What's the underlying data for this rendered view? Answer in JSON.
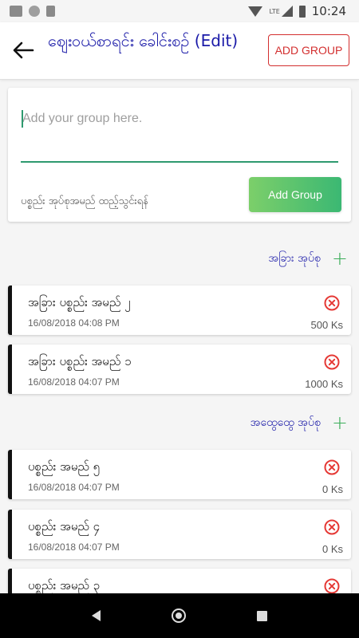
{
  "status_bar": {
    "time": "10:24",
    "network": "LTE"
  },
  "app_bar": {
    "title": "ဈေးဝယ်စာရင်း ခေါင်းစဉ် (Edit)",
    "add_group_label": "ADD GROUP"
  },
  "group_form": {
    "input_placeholder": "Add your group here.",
    "input_value": "",
    "hint": "ပစ္စည်း အုပ်စုအမည် ထည့်သွင်းရန်",
    "add_button_label": "Add Group"
  },
  "sections": [
    {
      "title": "အခြား အုပ်စု",
      "items": [
        {
          "name": "အခြား ပစ္စည်း အမည် ၂",
          "date": "16/08/2018 04:08 PM",
          "amount": "500 Ks"
        },
        {
          "name": "အခြား ပစ္စည်း အမည် ၁",
          "date": "16/08/2018 04:07 PM",
          "amount": "1000 Ks"
        }
      ]
    },
    {
      "title": "အထွေထွေ အုပ်စု",
      "items": [
        {
          "name": "ပစ္စည်း အမည် ၅",
          "date": "16/08/2018 04:07 PM",
          "amount": "0 Ks"
        },
        {
          "name": "ပစ္စည်း အမည် ၄",
          "date": "16/08/2018 04:07 PM",
          "amount": "0 Ks"
        },
        {
          "name": "ပစ္စည်း အမည် ၃",
          "date": "",
          "amount": ""
        }
      ]
    }
  ],
  "colors": {
    "accent": "#1a1aa8",
    "danger": "#d32f2f",
    "green": "#3bb873",
    "divider": "#2e9a6f"
  },
  "icons": {
    "back": "arrow-left-icon",
    "remove": "close-circle-icon",
    "add": "plus-icon"
  }
}
